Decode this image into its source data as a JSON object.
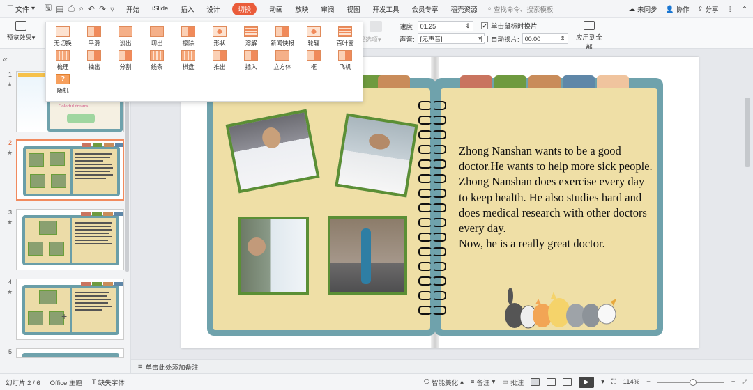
{
  "menubar": {
    "file_label": "文件",
    "tabs": [
      "开始",
      "iSlide",
      "插入",
      "设计",
      "切换",
      "动画",
      "放映",
      "审阅",
      "视图",
      "开发工具",
      "会员专享",
      "稻壳资源"
    ],
    "active_tab": "切换",
    "search_placeholder": "查找命令、搜索模板",
    "sync_label": "未同步",
    "collab_label": "协作",
    "share_label": "分享"
  },
  "toolbar": {
    "preview_label": "预览效果",
    "effect_options_label": "效果选项",
    "speed_label": "速度:",
    "speed_value": "01.25",
    "sound_label": "声音:",
    "sound_value": "[无声音]",
    "click_label": "单击鼠标时换片",
    "click_checked": true,
    "auto_label": "自动换片:",
    "auto_checked": false,
    "auto_value": "00:00",
    "apply_all_label": "应用到全部"
  },
  "transitions": {
    "row1": [
      "无切换",
      "平滑",
      "淡出",
      "切出",
      "擦除",
      "形状",
      "溶解",
      "新闻快报",
      "轮辐",
      "百叶窗"
    ],
    "row2": [
      "梳理",
      "抽出",
      "分割",
      "线条",
      "棋盘",
      "推出",
      "插入",
      "立方体",
      "框",
      "飞机"
    ],
    "row3": [
      "随机"
    ]
  },
  "slides": {
    "numbers": [
      "1",
      "2",
      "3",
      "4",
      "5"
    ],
    "active": "2",
    "thumb1_title": "Colorful dreams",
    "add_label": "+"
  },
  "slide_content": {
    "paragraphs": [
      "Zhong Nanshan wants to be a good doctor.He wants to help more sick people.",
      "Zhong Nanshan does exercise every day to keep health. He also studies hard and does medical research with other doctors every day.",
      "Now, he is a really great doctor."
    ],
    "tab_colors": [
      "#c9745f",
      "#6f9a3f",
      "#c98c5a",
      "#5f87a8",
      "#f0c49e"
    ],
    "book_color": "#6fa2ac",
    "page_color": "#efdfa6",
    "photo_border_color": "#5b8f35"
  },
  "notes": {
    "placeholder": "单击此处添加备注"
  },
  "status": {
    "slide_info": "幻灯片 2 / 6",
    "theme": "Office 主题",
    "missing_font": "缺失字体",
    "smart_beautify": "智能美化",
    "notes_label": "备注",
    "comments_label": "批注",
    "zoom": "114%"
  }
}
